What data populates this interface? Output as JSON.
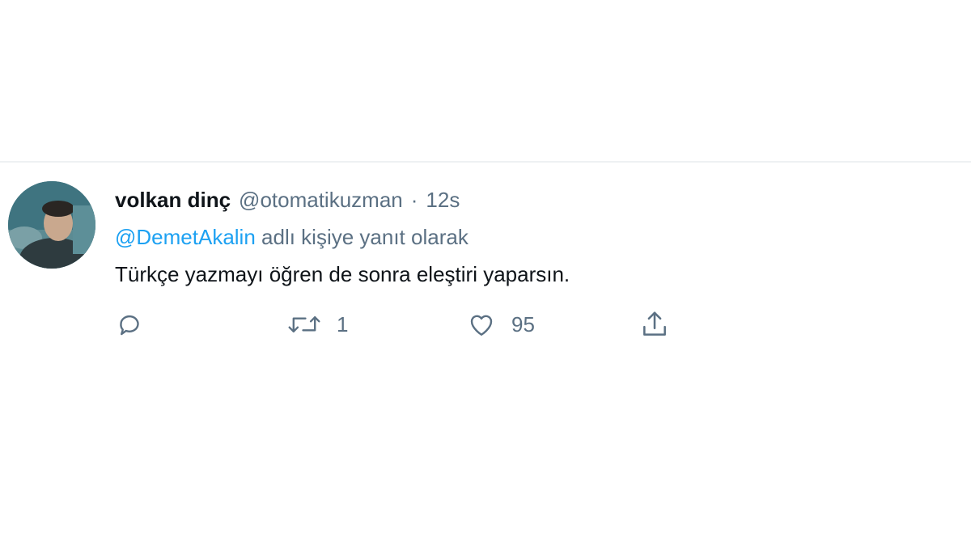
{
  "tweet": {
    "display_name": "volkan dinç",
    "handle": "@otomatikuzman",
    "separator": "·",
    "time": "12s",
    "reply_to_mention": "@DemetAkalin",
    "reply_to_suffix": "adlı kişiye yanıt olarak",
    "text": "Türkçe yazmayı öğren de sonra eleştiri yaparsın.",
    "actions": {
      "reply": {
        "icon": "reply-icon",
        "count": ""
      },
      "retweet": {
        "icon": "retweet-icon",
        "count": "1"
      },
      "like": {
        "icon": "heart-icon",
        "count": "95"
      },
      "share": {
        "icon": "share-icon",
        "count": ""
      }
    }
  },
  "colors": {
    "text": "#0f1419",
    "secondary": "#5b7083",
    "link": "#1da1f2",
    "divider": "#eef1f3"
  }
}
